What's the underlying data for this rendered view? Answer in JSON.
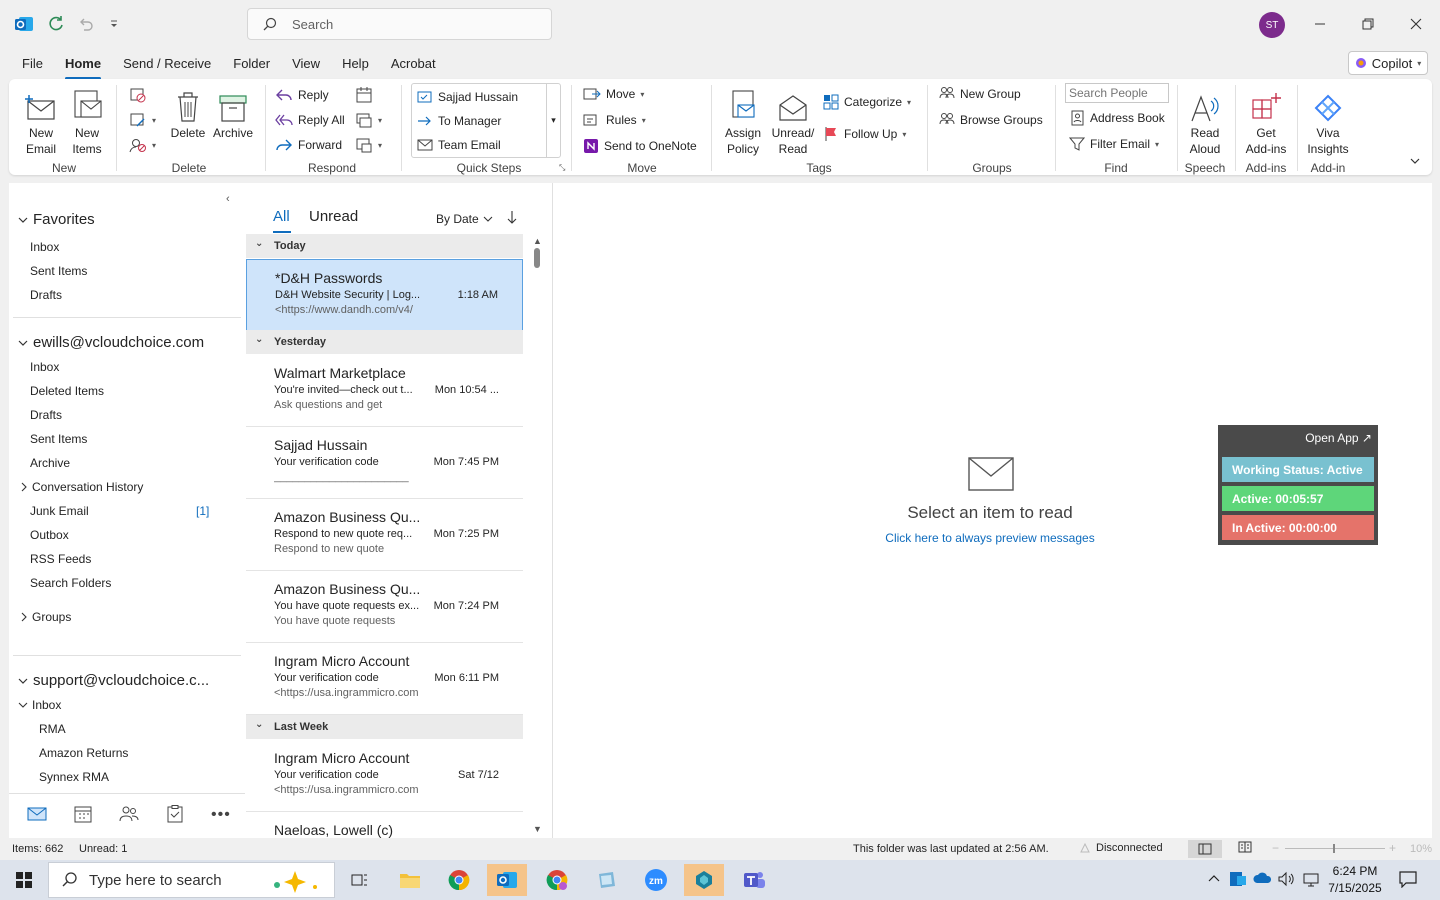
{
  "titlebar": {
    "search_placeholder": "Search",
    "avatar_initials": "ST"
  },
  "menu": {
    "tabs": [
      "File",
      "Home",
      "Send / Receive",
      "Folder",
      "View",
      "Help",
      "Acrobat"
    ],
    "active": "Home",
    "copilot": "Copilot"
  },
  "ribbon": {
    "new_email": "New Email",
    "new_items": "New Items",
    "group_new": "New",
    "delete": "Delete",
    "archive": "Archive",
    "group_delete": "Delete",
    "reply": "Reply",
    "reply_all": "Reply All",
    "forward": "Forward",
    "group_respond": "Respond",
    "quick_steps": [
      "Sajjad Hussain",
      "To Manager",
      "Team Email"
    ],
    "group_quick_steps": "Quick Steps",
    "move": "Move",
    "rules": "Rules",
    "send_onenote": "Send to OneNote",
    "group_move": "Move",
    "assign_policy": "Assign Policy",
    "unread_read": "Unread/ Read",
    "categorize": "Categorize",
    "follow_up": "Follow Up",
    "group_tags": "Tags",
    "new_group": "New Group",
    "browse_groups": "Browse Groups",
    "group_groups": "Groups",
    "search_people_placeholder": "Search People",
    "address_book": "Address Book",
    "filter_email": "Filter Email",
    "group_find": "Find",
    "read_aloud": "Read Aloud",
    "group_speech": "Speech",
    "get_addins": "Get Add-ins",
    "group_addins": "Add-ins",
    "viva_insights": "Viva Insights",
    "group_addin": "Add-in"
  },
  "folders": {
    "favorites_label": "Favorites",
    "favorites": [
      "Inbox",
      "Sent Items",
      "Drafts"
    ],
    "account1": "ewills@vcloudchoice.com",
    "account1_folders": [
      "Inbox",
      "Deleted Items",
      "Drafts",
      "Sent Items",
      "Archive",
      "Conversation History",
      "Junk Email",
      "Outbox",
      "RSS Feeds",
      "Search Folders"
    ],
    "junk_count": "[1]",
    "groups": "Groups",
    "account2": "support@vcloudchoice.c...",
    "account2_inbox": "Inbox",
    "account2_sub": [
      "RMA",
      "Amazon Returns",
      "Synnex RMA"
    ]
  },
  "list": {
    "tab_all": "All",
    "tab_unread": "Unread",
    "sort": "By Date",
    "groups": {
      "today": "Today",
      "yesterday": "Yesterday",
      "last_week": "Last Week"
    },
    "messages": [
      {
        "from": "*D&H Passwords",
        "subject": "D&H Website Security | Log...",
        "time": "1:18 AM",
        "preview": "<https://www.dandh.com/v4/"
      },
      {
        "from": "Walmart Marketplace",
        "subject": "You're invited—check out t...",
        "time": "Mon 10:54 ...",
        "preview": "Ask questions and get"
      },
      {
        "from": "Sajjad Hussain",
        "subject": "Your verification code",
        "time": "Mon 7:45 PM",
        "preview": "______________________"
      },
      {
        "from": "Amazon Business Qu...",
        "subject": "Respond to new quote req...",
        "time": "Mon 7:25 PM",
        "preview": "Respond to new quote"
      },
      {
        "from": "Amazon Business Qu...",
        "subject": "You have quote requests ex...",
        "time": "Mon 7:24 PM",
        "preview": "You have quote requests"
      },
      {
        "from": "Ingram Micro Account",
        "subject": "Your verification code",
        "time": "Mon 6:11 PM",
        "preview": "<https://usa.ingrammicro.com"
      },
      {
        "from": "Ingram Micro Account",
        "subject": "Your verification code",
        "time": "Sat 7/12",
        "preview": "<https://usa.ingrammicro.com"
      },
      {
        "from": "Naeloas, Lowell (c)",
        "subject": "",
        "time": "",
        "preview": ""
      }
    ]
  },
  "reading": {
    "select_text": "Select an item to read",
    "preview_link": "Click here to always preview messages"
  },
  "widget": {
    "open_app": "Open App ↗",
    "status": "Working Status: Active",
    "active": "Active: 00:05:57",
    "inactive": "In Active: 00:00:00",
    "colors": {
      "status": "#79c1d0",
      "active": "#5ed67a",
      "inactive": "#e5736a"
    }
  },
  "statusbar": {
    "items": "Items: 662",
    "unread": "Unread: 1",
    "updated": "This folder was last updated at 2:56 AM.",
    "connection": "Disconnected",
    "zoom": "10%"
  },
  "taskbar": {
    "search_placeholder": "Type here to search",
    "time": "6:24 PM",
    "date": "7/15/2025"
  }
}
